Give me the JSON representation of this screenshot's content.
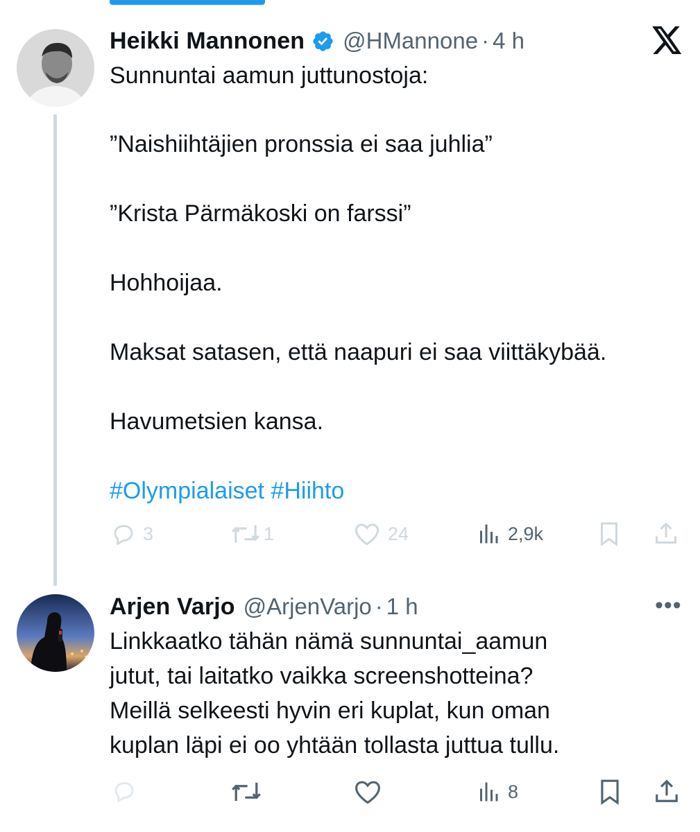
{
  "tweet1": {
    "name": "Heikki Mannonen",
    "handle": "@HMannone",
    "dot": "·",
    "time": "4 h",
    "lines": [
      "Sunnuntai aamun juttunostoja:",
      "",
      "”Naishiihtäjien pronssia ei saa juhlia”",
      "",
      "”Krista Pärmäkoski on farssi”",
      "",
      "Hohhoijaa.",
      "",
      "Maksat satasen, että naapuri ei saa viittäkybää.",
      "",
      "Havumetsien kansa.",
      ""
    ],
    "hashtags": "#Olympialaiset #Hiihto",
    "actions": {
      "replies": "3",
      "retweets": "1",
      "likes": "24",
      "views": "2,9k"
    }
  },
  "tweet2": {
    "name": "Arjen Varjo",
    "handle": "@ArjenVarjo",
    "dot": "·",
    "time": "1 h",
    "more": "•••",
    "lines": [
      "Linkkaatko tähän nämä sunnuntai_aamun",
      "jutut, tai laitatko vaikka screenshotteina?",
      "Meillä selkeesti hyvin eri kuplat, kun oman",
      "kuplan läpi ei oo yhtään tollasta juttua tullu."
    ],
    "actions": {
      "views": "8"
    }
  },
  "icons": {
    "verified": "verified-badge-icon",
    "x_logo": "x-logo-icon",
    "reply": "reply-icon",
    "retweet": "retweet-icon",
    "like": "heart-icon",
    "views": "views-icon",
    "bookmark": "bookmark-icon",
    "share": "share-icon"
  },
  "colors": {
    "accent": "#1d9bf0",
    "text": "#0f1419",
    "muted": "#536471",
    "faded": "#cfd9de"
  }
}
